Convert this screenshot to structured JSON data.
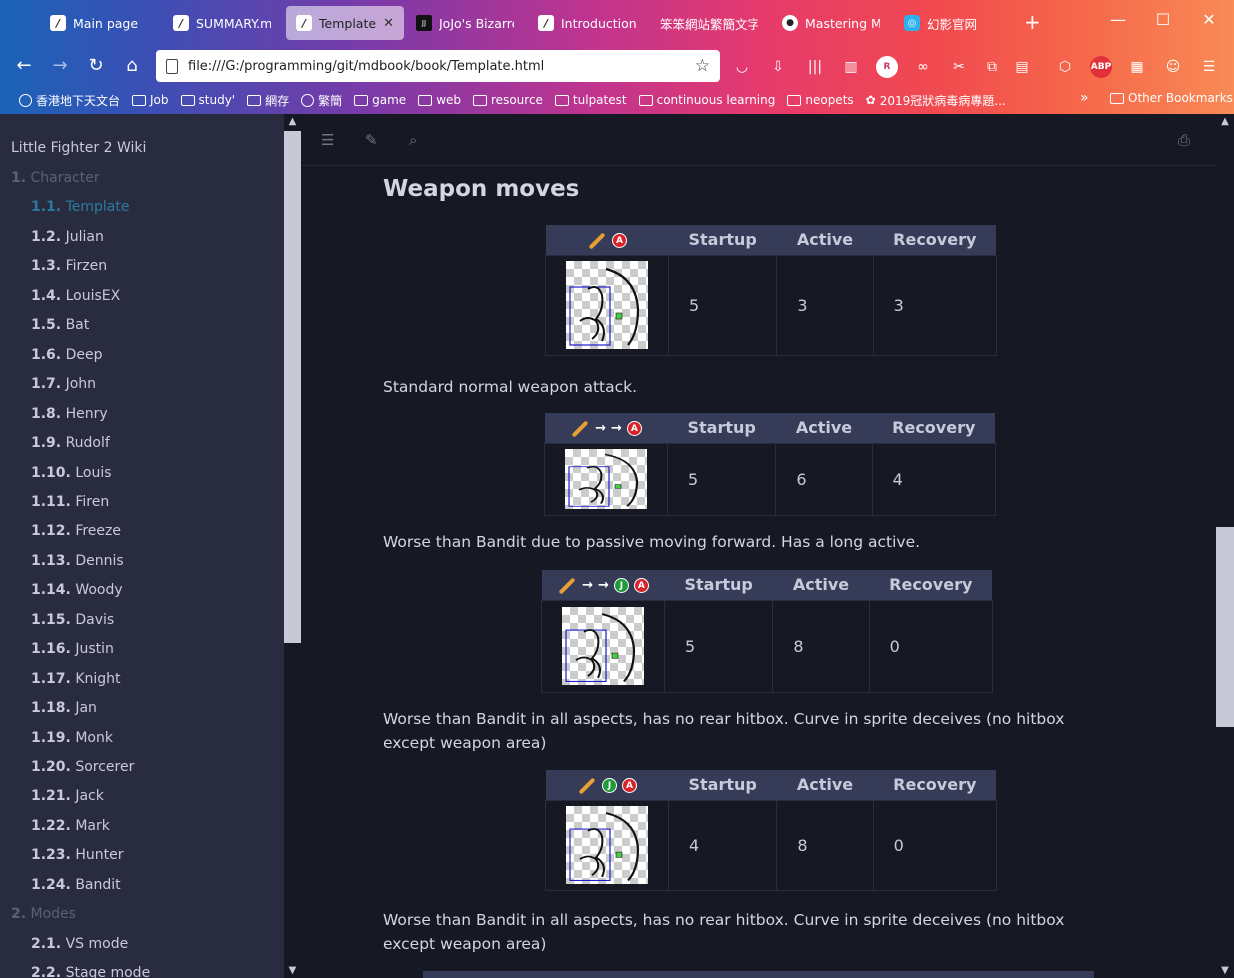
{
  "browser": {
    "tabs": [
      {
        "label": "Main page",
        "icon": "book-icon"
      },
      {
        "label": "SUMMARY.md",
        "icon": "book-icon"
      },
      {
        "label": "Template",
        "icon": "book-icon",
        "active": true
      },
      {
        "label": "JoJo's Bizarre A",
        "icon": "jojo-icon"
      },
      {
        "label": "Introduction -",
        "icon": "book-icon"
      },
      {
        "label": "笨笨網站繁簡文字",
        "icon": "kanji-icon"
      },
      {
        "label": "Mastering Mar",
        "icon": "github-icon"
      },
      {
        "label": "幻影官网",
        "icon": "phantom-icon"
      }
    ],
    "url": "file:///G:/programming/git/mdbook/book/Template.html",
    "bookmarks": [
      {
        "label": "香港地下天文台",
        "type": "globe"
      },
      {
        "label": "Job",
        "type": "folder"
      },
      {
        "label": "study'",
        "type": "folder"
      },
      {
        "label": "網存",
        "type": "folder"
      },
      {
        "label": "繁簡",
        "type": "globe"
      },
      {
        "label": "game",
        "type": "folder"
      },
      {
        "label": "web",
        "type": "folder"
      },
      {
        "label": "resource",
        "type": "folder"
      },
      {
        "label": "tulpatest",
        "type": "folder"
      },
      {
        "label": "continuous learning",
        "type": "folder"
      },
      {
        "label": "neopets",
        "type": "folder"
      },
      {
        "label": "2019冠狀病毒病專題...",
        "type": "flower"
      }
    ],
    "other_bookmarks": "Other Bookmarks",
    "toolbar_badges": {
      "reader": "R",
      "abp": "ABP"
    }
  },
  "sidebar": {
    "title": "Little Fighter 2 Wiki",
    "items": [
      {
        "num": "1.",
        "label": "Character",
        "kind": "section"
      },
      {
        "num": "1.1.",
        "label": "Template",
        "kind": "current"
      },
      {
        "num": "1.2.",
        "label": "Julian"
      },
      {
        "num": "1.3.",
        "label": "Firzen"
      },
      {
        "num": "1.4.",
        "label": "LouisEX"
      },
      {
        "num": "1.5.",
        "label": "Bat"
      },
      {
        "num": "1.6.",
        "label": "Deep"
      },
      {
        "num": "1.7.",
        "label": "John"
      },
      {
        "num": "1.8.",
        "label": "Henry"
      },
      {
        "num": "1.9.",
        "label": "Rudolf"
      },
      {
        "num": "1.10.",
        "label": "Louis"
      },
      {
        "num": "1.11.",
        "label": "Firen"
      },
      {
        "num": "1.12.",
        "label": "Freeze"
      },
      {
        "num": "1.13.",
        "label": "Dennis"
      },
      {
        "num": "1.14.",
        "label": "Woody"
      },
      {
        "num": "1.15.",
        "label": "Davis"
      },
      {
        "num": "1.16.",
        "label": "Justin"
      },
      {
        "num": "1.17.",
        "label": "Knight"
      },
      {
        "num": "1.18.",
        "label": "Jan"
      },
      {
        "num": "1.19.",
        "label": "Monk"
      },
      {
        "num": "1.20.",
        "label": "Sorcerer"
      },
      {
        "num": "1.21.",
        "label": "Jack"
      },
      {
        "num": "1.22.",
        "label": "Mark"
      },
      {
        "num": "1.23.",
        "label": "Hunter"
      },
      {
        "num": "1.24.",
        "label": "Bandit"
      },
      {
        "num": "2.",
        "label": "Modes",
        "kind": "section"
      },
      {
        "num": "2.1.",
        "label": "VS mode"
      },
      {
        "num": "2.2.",
        "label": "Stage mode"
      }
    ]
  },
  "content": {
    "heading": "Weapon moves",
    "columns": [
      "Startup",
      "Active",
      "Recovery"
    ],
    "moves": [
      {
        "inputs": [
          "stick",
          "A"
        ],
        "startup": "5",
        "active": "3",
        "recovery": "3",
        "desc": "Standard normal weapon attack."
      },
      {
        "inputs": [
          "stick",
          "→",
          "→",
          "A"
        ],
        "startup": "5",
        "active": "6",
        "recovery": "4",
        "desc": "Worse than Bandit due to passive moving forward. Has a long active."
      },
      {
        "inputs": [
          "stick",
          "→",
          "→",
          "J",
          "A"
        ],
        "startup": "5",
        "active": "8",
        "recovery": "0",
        "desc": "Worse than Bandit in all aspects, has no rear hitbox. Curve in sprite deceives (no hitbox except weapon area)"
      },
      {
        "inputs": [
          "stick",
          "J",
          "A"
        ],
        "startup": "4",
        "active": "8",
        "recovery": "0",
        "desc": "Worse than Bandit in all aspects, has no rear hitbox. Curve in sprite deceives (no hitbox except weapon area)"
      }
    ]
  },
  "colors": {
    "sidebar_bg": "#292c3f",
    "content_bg": "#161923",
    "table_header": "#363c57",
    "current_link": "#2b79a2",
    "text": "#c8c9db"
  }
}
